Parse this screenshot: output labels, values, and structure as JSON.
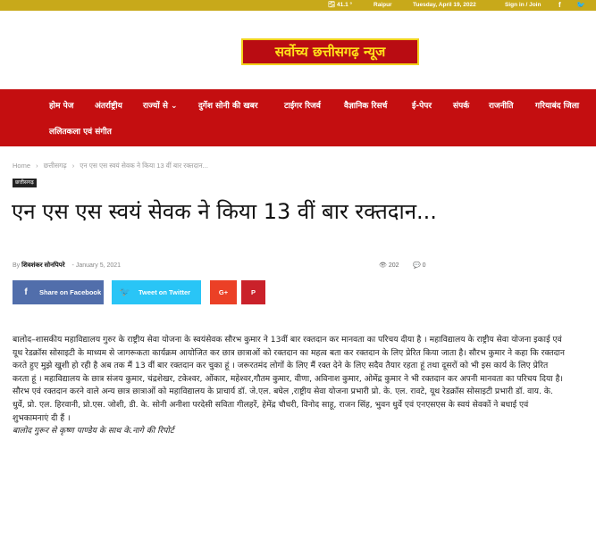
{
  "topbar": {
    "weather": "🌫 41.1 °",
    "city": "Raipur",
    "date": "Tuesday, April 19, 2022",
    "sign_in": "Sign in / Join",
    "social_fb": "f",
    "social_tw": "🐦"
  },
  "logo": {
    "text": "सर्वोच्य छत्तीसगढ़ न्यूज"
  },
  "nav": {
    "items": [
      "होम पेज",
      "अंतर्राष्ट्रीय",
      "राज्यों से ⌄",
      "दुर्गेश सोनी की खबर",
      "टाईगर रिजर्व",
      "वैज्ञानिक रिसर्च",
      "ई-पेपर",
      "संपर्क",
      "राजनीति",
      "गरियाबंद जिला",
      "ललितकला एवं संगीत"
    ]
  },
  "breadcrumb": {
    "home": "Home",
    "sep1": "›",
    "category": "छत्तीसगढ़",
    "sep2": "›",
    "current": "एन एस एस स्वयं सेवक ने किया 13 वीं बार रक्तदान..."
  },
  "article": {
    "category_badge": "छत्तीसगढ़",
    "title": "एन एस एस स्वयं सेवक ने किया 13 वीं बार रक्तदान...",
    "by": "By",
    "author": "शिवशंकर सोनपिपरे",
    "date_sep": "-",
    "date": "January 5, 2021",
    "views_icon": "👁",
    "views": "202",
    "comments_icon": "💬",
    "comments": "0",
    "share_facebook": "Share on Facebook",
    "share_twitter": "Tweet on Twitter",
    "share_gplus": "G+",
    "share_pinterest": "P",
    "body": "बालोद–शासकीय महाविद्यालय गुरुर के राष्ट्रीय सेवा योजना के स्वयंसेवक सौरभ कुमार ने 13वीं बार रक्तदान कर मानवता का परिचय दीया है । महाविद्यालय के राष्ट्रीय सेवा योजना इकाई एवं यूथ रेडक्रॉस सोसाइटी के माध्यम से जागरूकता कार्यक्रम आयोजित कर छात्र छात्राओं को रक्तदान का महत्व बता कर रक्तदान के लिए प्रेरित किया जाता है। सौरभ कुमार ने कहा कि रक्तदान करते हुए मुझे खुशी हो रही है अब तक मैं 13 वीं बार रक्तदान कर चुका हूं । जरूरतमंद लोगों के लिए मैं रक्त देने के लिए सदैव तैयार रहता हूं तथा दूसरों को भी इस कार्य के लिए प्रेरित करता हूं । महाविद्यालय के छात्र संजय कुमार, चंद्रशेखर, टकेश्वर, ओंकार, महेश्वर,गौतम कुमार, वीणा, अविनाश कुमार, ओमेंद्र कुमार ने भी रक्तदान कर अपनी मानवता का परिचय दिया है। सौरभ एवं रक्तदान करने वाले अन्य छात्र छात्राओं को महाविद्यालय के प्राचार्य डॉ. जे.एल. बघेल ,राष्ट्रीय सेवा योजना प्रभारी प्रो. के. एल. रावटे, यूथ रेडक्रॉस सोसाइटी प्रभारी डॉ. वाय. के. धुर्वे, प्रो. एल. हिरवानी, प्रो.एस. जोशी, डी. के. सोनी अनीशा परदेसी सविता गीलहरें, हेमेंद्र चौधरी, विनोद साहू, राजन सिंह, भुवन धुर्वे एवं एनएसएस के स्वयं सेवकों ने बधाई एवं शुभकामनाएं दी हैं ।",
    "credit": "बालोद गुरूर से कृष्ण पाण्डेय के साथ के.नागे की रिपोर्ट"
  }
}
